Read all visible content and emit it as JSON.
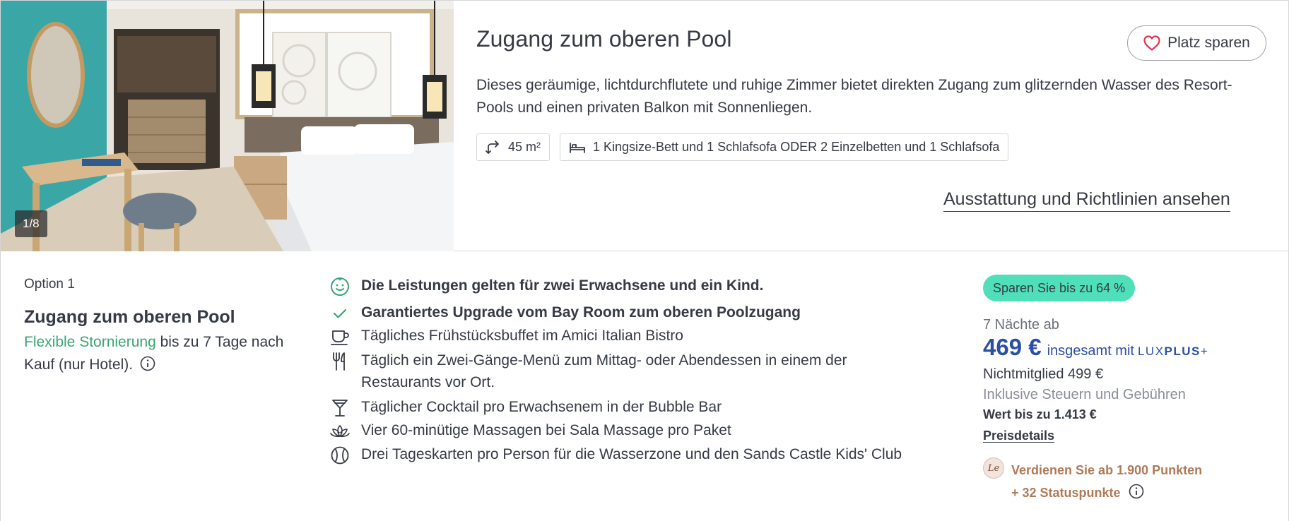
{
  "room": {
    "photo_counter": "1/8",
    "title": "Zugang zum oberen Pool",
    "save_label": "Platz sparen",
    "description": "Dieses geräumige, lichtdurchflutete und ruhige Zimmer bietet direkten Zugang zum glitzernden Wasser des Resort-Pools und einen privaten Balkon mit Sonnenliegen.",
    "size": "45 m²",
    "beds": "1 Kingsize-Bett und 1 Schlafsofa ODER 2 Einzelbetten und 1 Schlafsofa",
    "amenities_link": "Ausstattung und Richtlinien ansehen"
  },
  "option": {
    "label": "Option 1",
    "title": "Zugang zum oberen Pool",
    "flexible_cancel": "Flexible Stornierung",
    "cancel_rest": " bis zu 7 Tage nach Kauf (nur Hotel)."
  },
  "inclusions": [
    {
      "icon": "smiley-icon",
      "text": "Die Leistungen gelten für zwei Erwachsene und ein Kind."
    },
    {
      "icon": "checkmark-icon",
      "text": "Garantiertes Upgrade vom Bay Room zum oberen Poolzugang"
    },
    {
      "icon": "coffee-cup-icon",
      "text": "Tägliches Frühstücksbuffet im Amici Italian Bistro"
    },
    {
      "icon": "cutlery-icon",
      "text": "Täglich ein Zwei-Gänge-Menü zum Mittag- oder Abendessen in einem der Restaurants vor Ort."
    },
    {
      "icon": "cocktail-icon",
      "text": "Täglicher Cocktail pro Erwachsenem in der Bubble Bar"
    },
    {
      "icon": "lotus-icon",
      "text": "Vier 60-minütige Massagen bei Sala Massage pro Paket"
    },
    {
      "icon": "tennis-ball-icon",
      "text": "Drei Tageskarten pro Person für die Wasserzone und den Sands Castle Kids' Club"
    }
  ],
  "pricing": {
    "savings_badge": "Sparen Sie bis zu 64 %",
    "nights": "7 Nächte ab",
    "price": "469 €",
    "price_suffix": "insgesamt mit",
    "luxplus_light": "LUX",
    "luxplus_bold": "PLUS",
    "luxplus_plus": "+",
    "nonmember_label": "Nichtmitglied",
    "nonmember_price": "499 €",
    "taxes": "Inklusive Steuern und Gebühren",
    "worth": "Wert bis zu 1.413 €",
    "details_link": "Preisdetails",
    "points_logo": "Le",
    "points_line1": "Verdienen Sie ab 1.900 Punkten",
    "points_line2": "+ 32 Statuspunkte"
  },
  "colors": {
    "accent_blue": "#2b4fa3",
    "badge_green": "#4fe0ba",
    "flexible_green": "#3aa573",
    "points_brown": "#b07a58",
    "heart_red": "#e0334f"
  }
}
